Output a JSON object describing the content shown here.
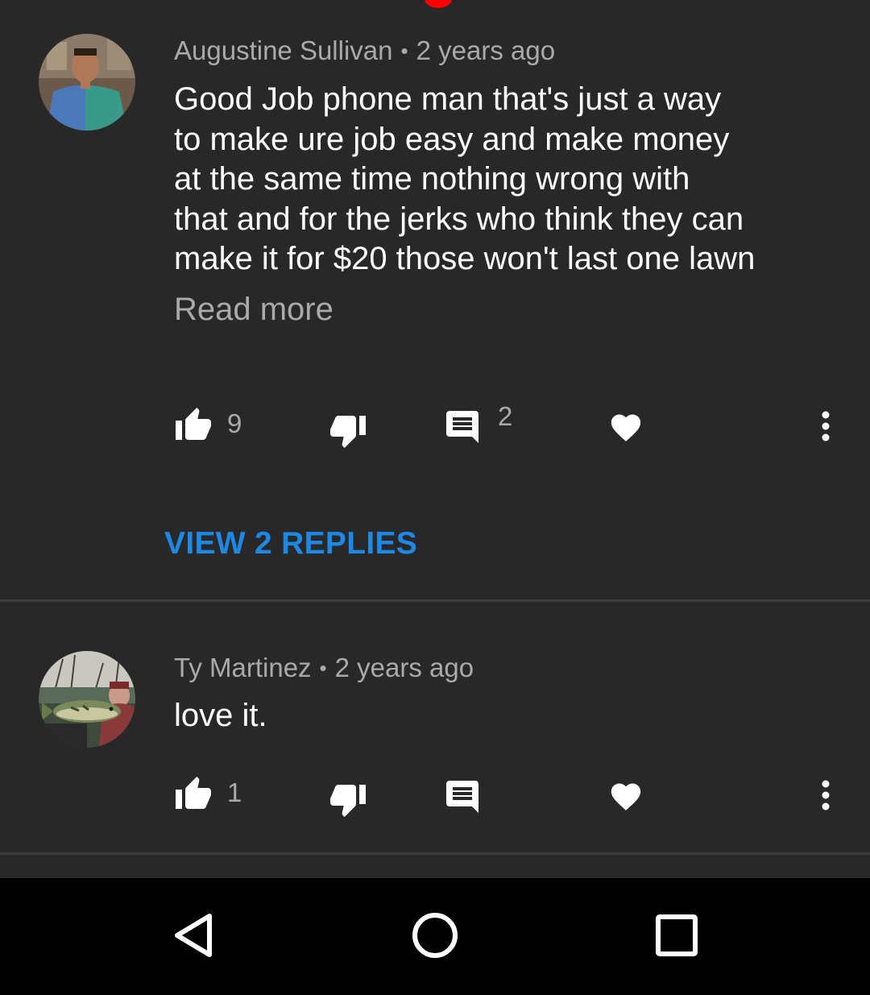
{
  "comments": [
    {
      "author": "Augustine Sullivan",
      "separator": "•",
      "time": "2 years ago",
      "text_lines": [
        "Good Job phone man that's just a way",
        "to make ure job easy and make money",
        "at the same time nothing wrong with",
        "that and for the jerks who think they can",
        "make it for $20 those won't last one lawn"
      ],
      "read_more": "Read more",
      "likes": "9",
      "replies_count": "2",
      "view_replies": "VIEW 2 REPLIES"
    },
    {
      "author": "Ty Martinez",
      "separator": "•",
      "time": "2 years ago",
      "text": "love it.",
      "likes": "1"
    }
  ],
  "icons": {
    "like": "thumb-up-icon",
    "dislike": "thumb-down-icon",
    "reply": "comment-icon",
    "heart": "heart-icon",
    "more": "more-vert-icon",
    "nav_back": "back-triangle-icon",
    "nav_home": "home-circle-icon",
    "nav_recents": "recents-square-icon"
  },
  "colors": {
    "background": "#282828",
    "link_blue": "#1e88e5",
    "indicator_red": "#ff0000",
    "secondary_text": "#aaaaaa"
  }
}
